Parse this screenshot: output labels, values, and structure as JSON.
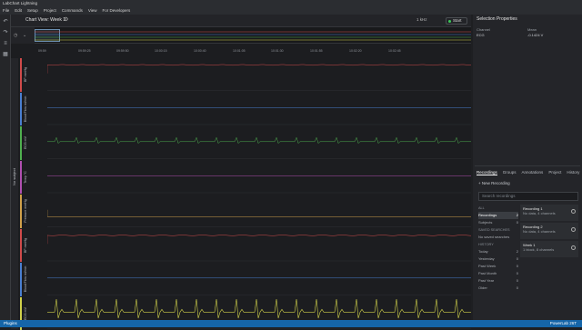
{
  "app": {
    "title": "LabChart Lightning"
  },
  "menu": [
    "File",
    "Edit",
    "Setup",
    "Project",
    "Commands",
    "View",
    "For Developers"
  ],
  "chart_view": {
    "title": "Chart View: Week 1",
    "rate": "1 kHz",
    "start_label": "Start",
    "time_ticks": [
      "09:59",
      "09:59:25",
      "09:59:50",
      "10:00:15",
      "10:00:40",
      "10:01:05",
      "10:01:30",
      "10:01:55",
      "10:02:20",
      "10:02:45"
    ],
    "subject_label": "No subject",
    "channels": [
      {
        "name": "BP",
        "unit": "mmHg",
        "color": "#d04a4a"
      },
      {
        "name": "Blood Flow",
        "unit": "ml/min",
        "color": "#4a7fd0"
      },
      {
        "name": "ECG",
        "unit": "mV",
        "color": "#4fb04f"
      },
      {
        "name": "Temp",
        "unit": "°C",
        "color": "#b04fb0"
      },
      {
        "name": "Pressure",
        "unit": "mmHg",
        "color": "#d0a04a"
      },
      {
        "name": "BP",
        "unit": "mmHg",
        "color": "#d04a4a"
      },
      {
        "name": "Blood Flow",
        "unit": "ml/min",
        "color": "#4a7fd0"
      },
      {
        "name": "ECG",
        "unit": "mV",
        "color": "#cfd04a"
      }
    ]
  },
  "selection": {
    "title": "Selection Properties",
    "col_channel": "Channel",
    "col_mean": "Mean",
    "channel_value": "ECG",
    "mean_value": "-0.1424 V"
  },
  "recordings": {
    "tabs": [
      "Recordings",
      "Groups",
      "Annotations",
      "Project",
      "History"
    ],
    "active_tab": "Recordings",
    "new_recording": "+ New Recording",
    "search_placeholder": "Search recordings",
    "filters_all_header": "ALL",
    "filters": [
      {
        "label": "Recordings",
        "count": "2"
      },
      {
        "label": "Subjects",
        "count": "0"
      }
    ],
    "saved_header": "SAVED SEARCHES",
    "saved_empty": "No saved searches",
    "history_header": "HISTORY",
    "history": [
      {
        "label": "Today",
        "count": "2"
      },
      {
        "label": "Yesterday",
        "count": "0"
      },
      {
        "label": "Past Week",
        "count": "0"
      },
      {
        "label": "Past Month",
        "count": "0"
      },
      {
        "label": "Past Year",
        "count": "0"
      },
      {
        "label": "Older",
        "count": "0"
      }
    ],
    "items": [
      {
        "title": "Recording 1",
        "sub": "No data, 4 channels"
      },
      {
        "title": "Recording 2",
        "sub": "No data, 4 channels"
      },
      {
        "title": "Week 1",
        "sub": "1 block, 8 channels"
      }
    ]
  },
  "status": {
    "left": "Plugins",
    "right": "PowerLab 26T"
  }
}
